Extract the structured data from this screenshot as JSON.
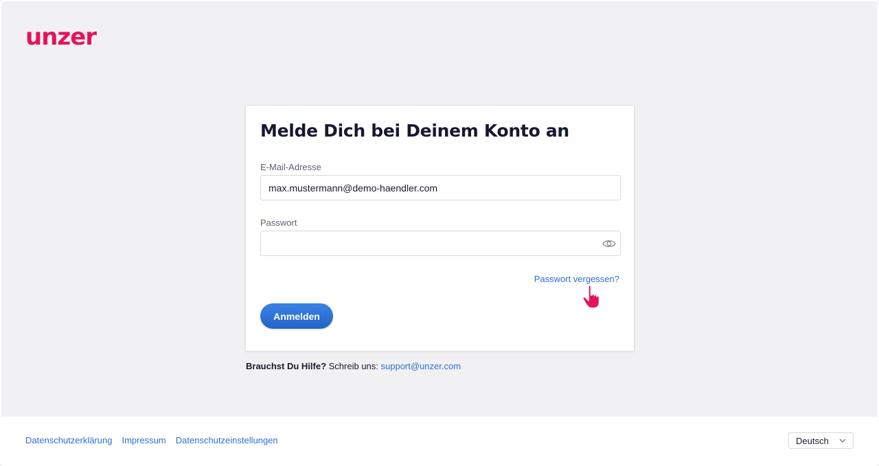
{
  "brand": {
    "logo_text": "unzer",
    "accent": "#e5145a",
    "link_color": "#2f6fd6",
    "button_color": "#2a6fd8"
  },
  "login": {
    "title": "Melde Dich bei Deinem Konto an",
    "email_label": "E-Mail-Adresse",
    "email_value": "max.mustermann@demo-haendler.com",
    "password_label": "Passwort",
    "password_value": "",
    "show_password_icon": "eye-icon",
    "forgot_link": "Passwort vergessen?",
    "submit_label": "Anmelden"
  },
  "help": {
    "bold": "Brauchst Du Hilfe?",
    "text": " Schreib uns: ",
    "email": "support@unzer.com"
  },
  "footer": {
    "links": [
      "Datenschutzerklärung",
      "Impressum",
      "Datenschutzeinstellungen"
    ],
    "language": "Deutsch"
  }
}
